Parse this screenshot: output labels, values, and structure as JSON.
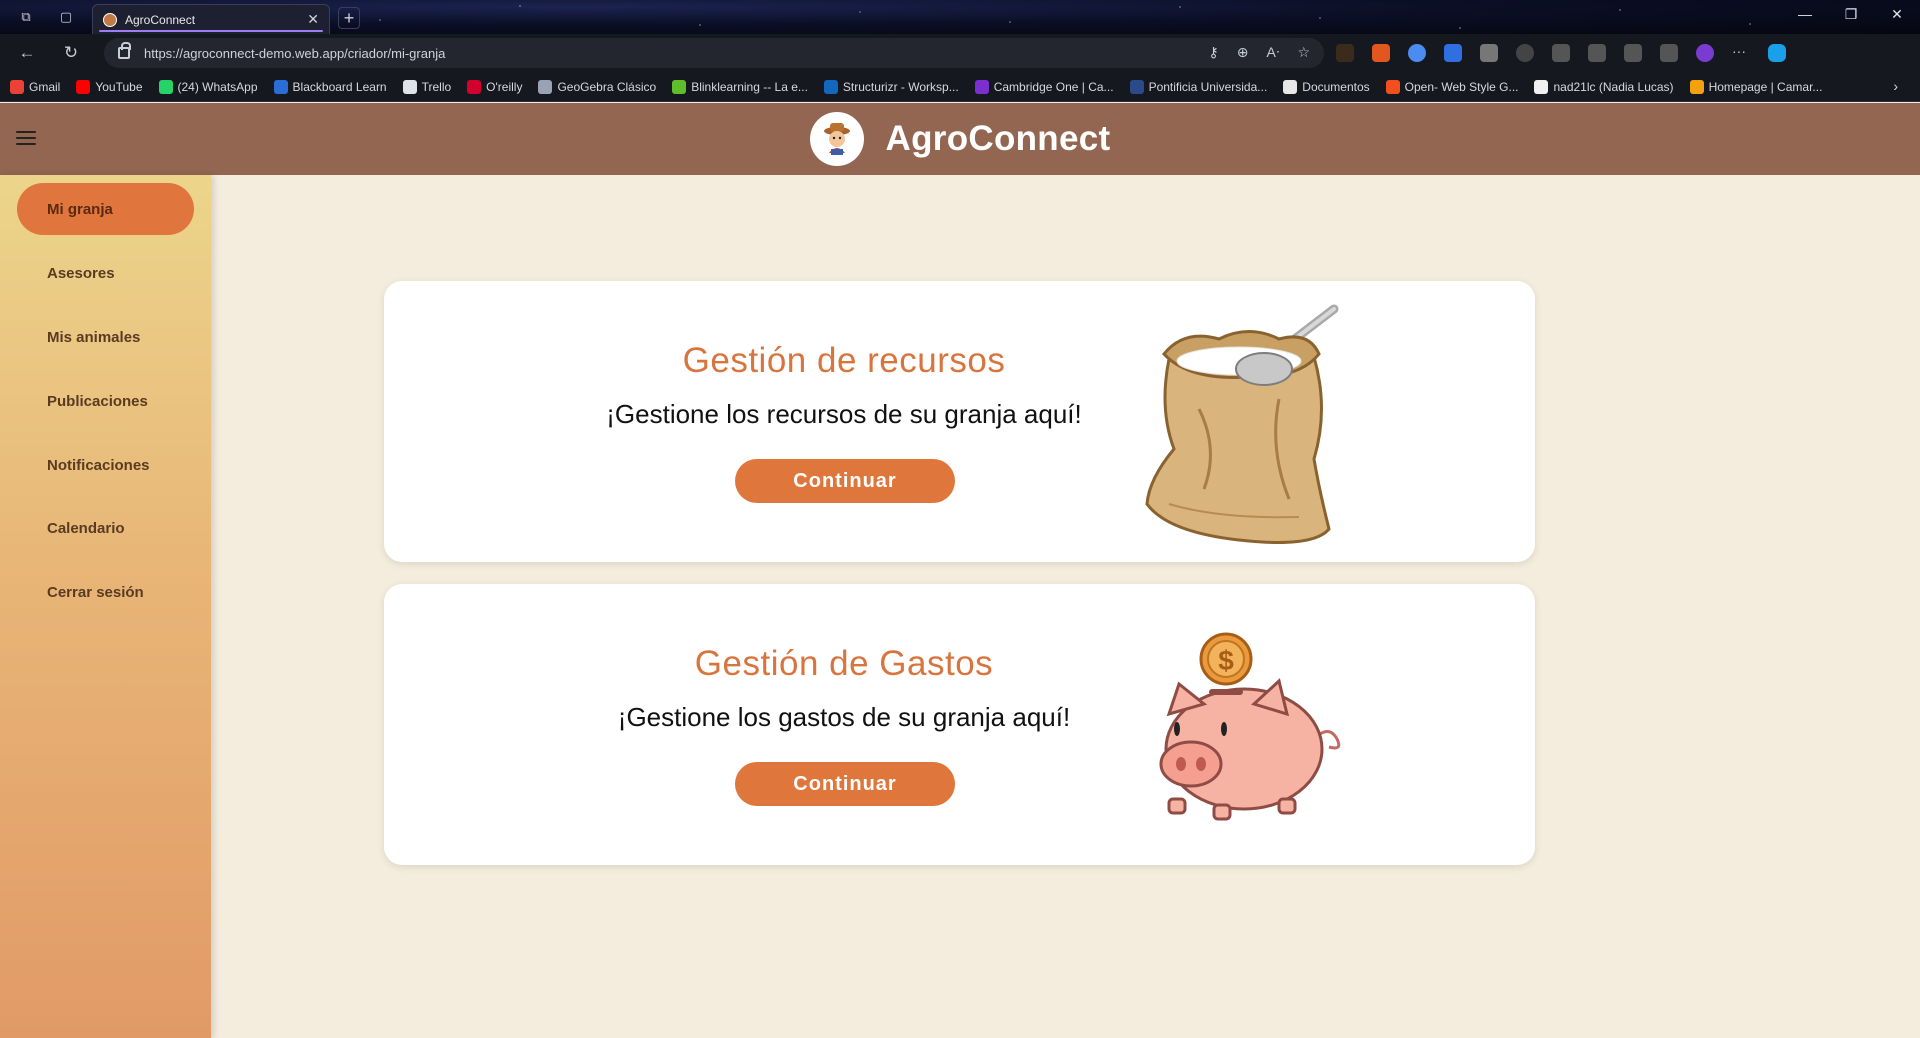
{
  "browser": {
    "tab_title": "AgroConnect",
    "url": "https://agroconnect-demo.web.app/criador/mi-granja",
    "bookmarks": [
      {
        "label": "Gmail",
        "color": "#ea4335"
      },
      {
        "label": "YouTube",
        "color": "#ff0000"
      },
      {
        "label": "(24) WhatsApp",
        "color": "#25d366"
      },
      {
        "label": "Blackboard Learn",
        "color": "#2b6dd6"
      },
      {
        "label": "Trello",
        "color": "#dfe3ea"
      },
      {
        "label": "O'reilly",
        "color": "#d3002d"
      },
      {
        "label": "GeoGebra Clásico",
        "color": "#9aa3b5"
      },
      {
        "label": "Blinklearning -- La e...",
        "color": "#5fbf2a"
      },
      {
        "label": "Structurizr - Worksp...",
        "color": "#1168bd"
      },
      {
        "label": "Cambridge One | Ca...",
        "color": "#7b2fd1"
      },
      {
        "label": "Pontificia Universida...",
        "color": "#2a4a8a"
      },
      {
        "label": "Documentos",
        "color": "#e8e8e8"
      },
      {
        "label": "Open- Web Style G...",
        "color": "#f24e1e"
      },
      {
        "label": "nad21lc (Nadia Lucas)",
        "color": "#f0f0f0"
      },
      {
        "label": "Homepage | Camar...",
        "color": "#f1a20d"
      }
    ]
  },
  "app": {
    "title": "AgroConnect",
    "brand_color": "#926651",
    "accent_color": "#df763c"
  },
  "sidebar": {
    "items": [
      {
        "label": "Mi granja",
        "active": true
      },
      {
        "label": "Asesores"
      },
      {
        "label": "Mis animales"
      },
      {
        "label": "Publicaciones"
      },
      {
        "label": "Notificaciones"
      },
      {
        "label": "Calendario"
      },
      {
        "label": "Cerrar sesión"
      }
    ]
  },
  "cards": [
    {
      "title": "Gestión de recursos",
      "subtitle": "¡Gestione los recursos de su granja aquí!",
      "button": "Continuar",
      "image": "sack-of-flour-illustration"
    },
    {
      "title": "Gestión de Gastos",
      "subtitle": "¡Gestione los gastos de su granja aquí!",
      "button": "Continuar",
      "image": "piggy-bank-illustration"
    }
  ]
}
